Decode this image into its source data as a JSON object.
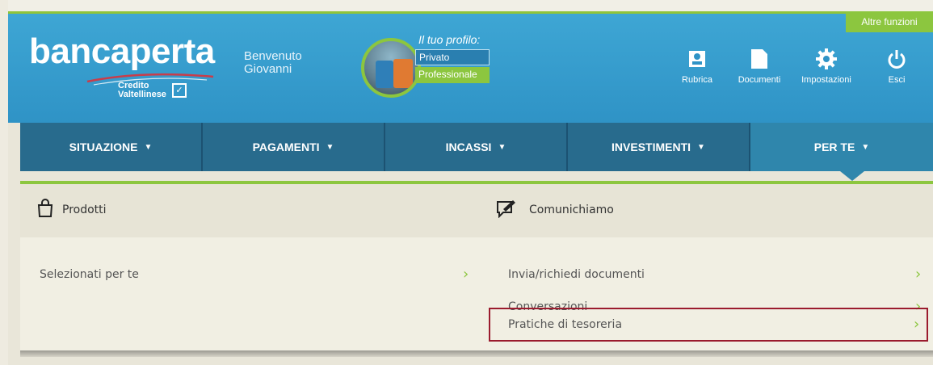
{
  "header": {
    "logo_text": "bancaperta",
    "logo_sub": "Credito Valtellinese",
    "welcome_line1": "Benvenuto",
    "welcome_line2": "Giovanni",
    "profile": {
      "title": "Il tuo profilo:",
      "options": [
        "Privato",
        "Professionale"
      ],
      "selected": "Professionale"
    },
    "altre_funzioni": "Altre funzioni",
    "icons": [
      {
        "label": "Rubrica",
        "icon": "address-book-icon"
      },
      {
        "label": "Documenti",
        "icon": "document-icon"
      },
      {
        "label": "Impostazioni",
        "icon": "gear-icon"
      },
      {
        "label": "Esci",
        "icon": "power-icon"
      }
    ]
  },
  "nav": {
    "items": [
      {
        "label": "SITUAZIONE"
      },
      {
        "label": "PAGAMENTI"
      },
      {
        "label": "INCASSI"
      },
      {
        "label": "INVESTIMENTI"
      },
      {
        "label": "PER TE"
      }
    ],
    "active": "PER TE"
  },
  "dropdown": {
    "prodotti": {
      "title": "Prodotti",
      "icon": "shopping-bag-icon",
      "links": [
        "Selezionati per te"
      ]
    },
    "comunichiamo": {
      "title": "Comunichiamo",
      "icon": "chat-edit-icon",
      "links": [
        "Invia/richiedi documenti",
        "Conversazioni",
        "Pratiche di tesoreria"
      ]
    },
    "highlighted_link": "Pratiche di tesoreria"
  },
  "colors": {
    "header_blue": "#3ea6d4",
    "nav_blue": "#286b8d",
    "accent_green": "#8cc63f",
    "highlight_red": "#9b1b2e"
  }
}
